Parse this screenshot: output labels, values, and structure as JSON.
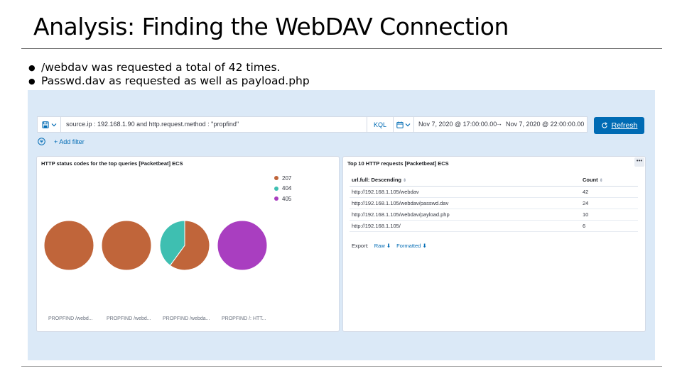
{
  "slide": {
    "title": "Analysis: Finding the WebDAV Connection",
    "bullets": [
      "/webdav was requested  a total of 42 times.",
      "Passwd.dav as requested  as well as payload.php"
    ]
  },
  "kibana": {
    "query": {
      "text": "source.ip : 192.168.1.90 and http.request.method : \"propfind\"",
      "language_label": "KQL",
      "saved_icon": "save-icon"
    },
    "time": {
      "start": "Nov 7, 2020 @ 17:00:00.00",
      "arrow": "→",
      "end": "Nov 7, 2020 @ 22:00:00.00",
      "calendar_icon": "calendar-icon"
    },
    "refresh_label": "Refresh",
    "add_filter_label": "+ Add filter",
    "accent": "#006bb4"
  },
  "left_panel": {
    "title": "HTTP status codes for the top queries [Packetbeat] ECS",
    "legend": [
      {
        "label": "207",
        "color": "#c0653a"
      },
      {
        "label": "404",
        "color": "#3ebfb1"
      },
      {
        "label": "405",
        "color": "#a93ec0"
      }
    ],
    "pie_labels": [
      "PROPFIND /webd...",
      "PROPFIND /webd...",
      "PROPFIND /webda...",
      "PROPFIND /: HTT..."
    ]
  },
  "chart_data": {
    "type": "pie",
    "title": "HTTP status codes for the top queries [Packetbeat] ECS",
    "categories": [
      "207",
      "404",
      "405"
    ],
    "colors": [
      "#c0653a",
      "#3ebfb1",
      "#a93ec0"
    ],
    "pies": [
      {
        "label": "PROPFIND /webd...",
        "slices": [
          {
            "name": "207",
            "value": 1.0
          }
        ]
      },
      {
        "label": "PROPFIND /webd...",
        "slices": [
          {
            "name": "207",
            "value": 1.0
          }
        ]
      },
      {
        "label": "PROPFIND /webda...",
        "slices": [
          {
            "name": "207",
            "value": 0.6
          },
          {
            "name": "404",
            "value": 0.4
          }
        ]
      },
      {
        "label": "PROPFIND /: HTT...",
        "slices": [
          {
            "name": "405",
            "value": 1.0
          }
        ]
      }
    ]
  },
  "right_panel": {
    "title": "Top 10 HTTP requests [Packetbeat] ECS",
    "columns": [
      "url.full: Descending",
      "Count"
    ],
    "rows": [
      {
        "url": "http://192.168.1.105/webdav",
        "count": "42"
      },
      {
        "url": "http://192.168.1.105/webdav/passwd.dav",
        "count": "24"
      },
      {
        "url": "http://192.168.1.105/webdav/payload.php",
        "count": "10"
      },
      {
        "url": "http://192.168.1.105/",
        "count": "6"
      }
    ],
    "export_label": "Export:",
    "raw_label": "Raw",
    "formatted_label": "Formatted",
    "menu_glyph": "•••"
  }
}
